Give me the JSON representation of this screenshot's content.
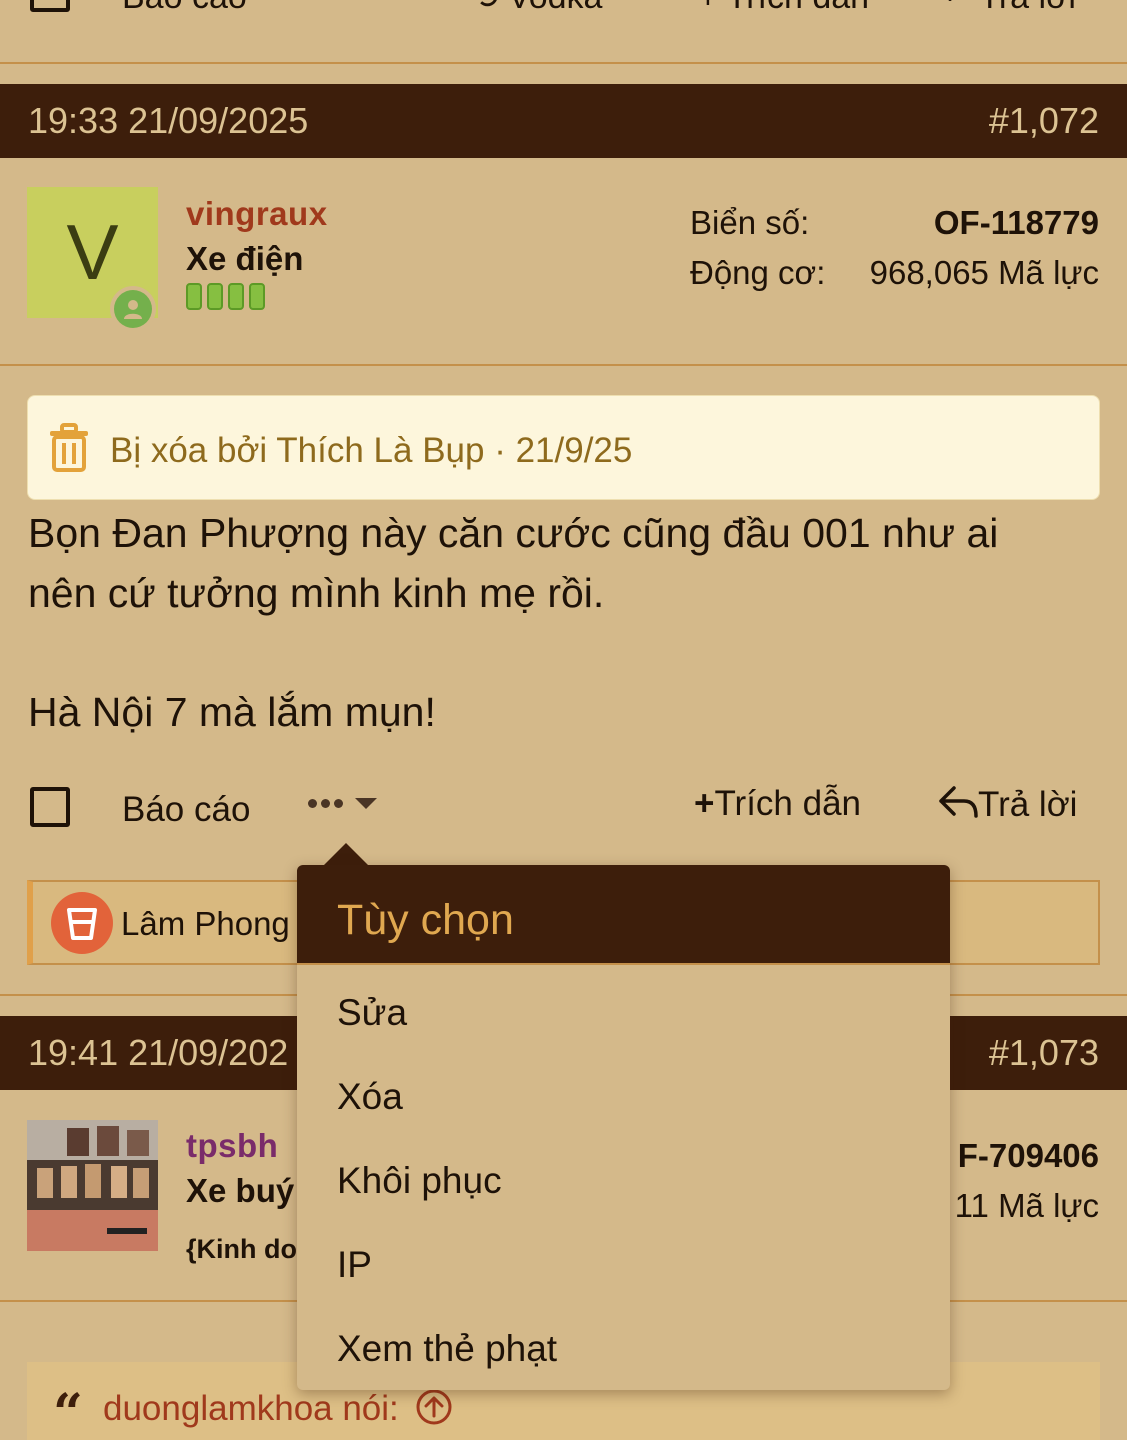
{
  "top_actions": {
    "report": "Báo cáo",
    "reaction": "Vodka",
    "quote": "Trích dẫn",
    "reply": "Trả lời"
  },
  "post1": {
    "time": "19:33 21/09/2025",
    "number": "#1,072",
    "avatar_letter": "V",
    "username": "vingraux",
    "username_color": "#a0391c",
    "user_title": "Xe điện",
    "plate_label": "Biển số:",
    "plate_value": "OF-118779",
    "engine_label": "Động cơ:",
    "engine_value": "968,065 Mã lực",
    "deleted_notice": "Bị xóa bởi Thích Là Bụp · 21/9/25",
    "message_line1": "Bọn Đan Phượng này căn cước cũng đầu 001 như ai",
    "message_line2": "nên cứ tưởng mình kinh mẹ rồi.",
    "message_line3": "Hà Nội 7 mà lắm mụn!",
    "report_label": "Báo cáo",
    "quote_label": "Trích dẫn",
    "reply_label": "Trả lời",
    "reaction_user": "Lâm Phong"
  },
  "post2": {
    "time": "19:41 21/09/202",
    "number": "#1,073",
    "username": "tpsbh",
    "username_color": "#7a2b6a",
    "user_title": "Xe buý",
    "user_sub": "{Kinh do",
    "plate_value": "F-709406",
    "engine_value": "11 Mã lực",
    "quote_author": "duonglamkhoa nói:"
  },
  "dropdown": {
    "title": "Tùy chọn",
    "items": [
      "Sửa",
      "Xóa",
      "Khôi phục",
      "IP",
      "Xem thẻ phạt"
    ]
  },
  "colors": {
    "background": "#d4b98a",
    "header": "#3d1e0b",
    "accent": "#e0a850",
    "deleted_bg": "#fdf6dc",
    "deleted_text": "#8e6a1d"
  }
}
